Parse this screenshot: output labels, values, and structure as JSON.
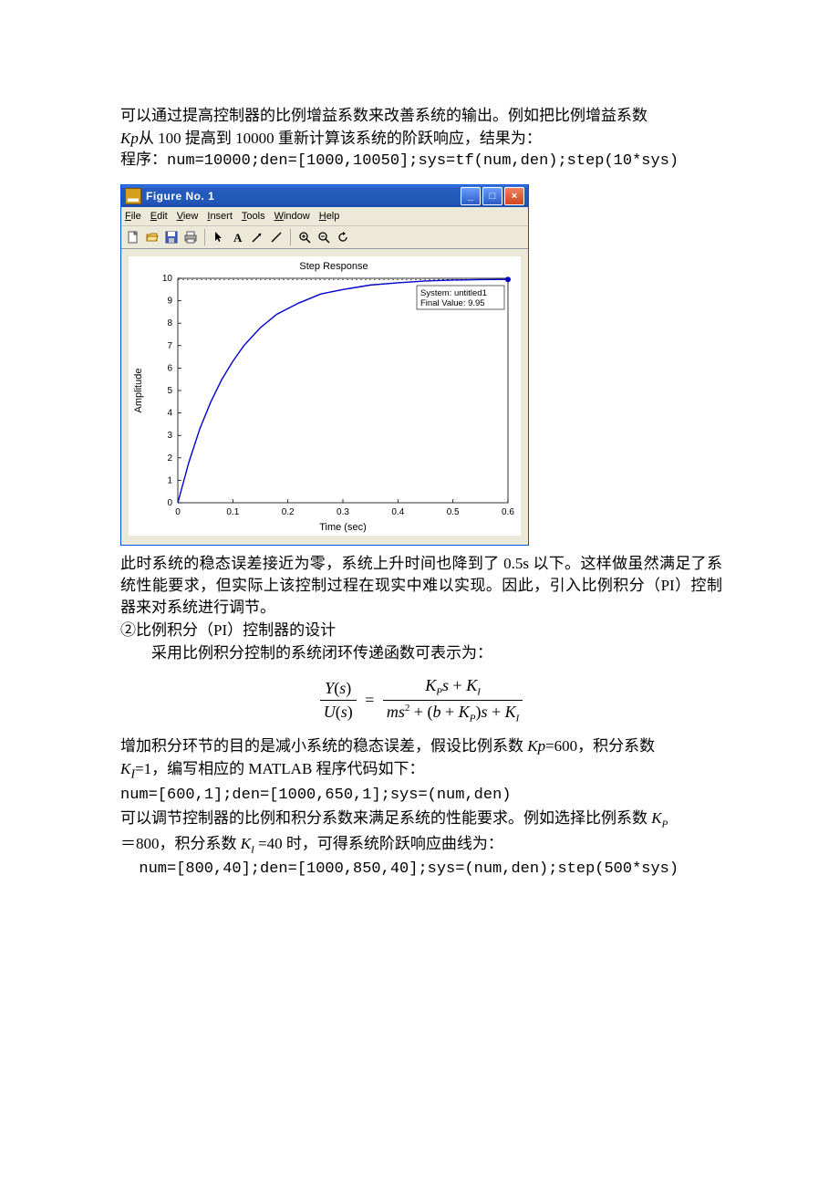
{
  "text": {
    "p1": "可以通过提高控制器的比例增益系数来改善系统的输出。例如把比例增益系数",
    "p2a": "从 100 提高到 10000 重新计算该系统的阶跃响应，结果为：",
    "p3": "程序：num=10000;den=[1000,10050];sys=tf(num,den);step(10*sys)",
    "p4": "此时系统的稳态误差接近为零，系统上升时间也降到了 0.5s 以下。这样做虽然满足了系统性能要求，但实际上该控制过程在现实中难以实现。因此，引入比例积分（PI）控制器来对系统进行调节。",
    "p5": "②比例积分（PI）控制器的设计",
    "p6": "采用比例积分控制的系统闭环传递函数可表示为：",
    "p7a": "增加积分环节的目的是减小系统的稳态误差，假设比例系数 ",
    "p7b": "=600，积分系数",
    "p8a": "=1，编写相应的 MATLAB 程序代码如下：",
    "p9": "num=[600,1];den=[1000,650,1];sys=(num,den)",
    "p10a": "可以调节控制器的比例和积分系数来满足系统的性能要求。例如选择比例系数 ",
    "p11a": "＝800，积分系数 ",
    "p11b": " =40 时，可得系统阶跃响应曲线为：",
    "p12": "num=[800,40];den=[1000,850,40];sys=(num,den);step(500*sys)",
    "kp": "Kp",
    "ki": "K",
    "ki_sub": "I"
  },
  "window": {
    "title": "Figure No. 1",
    "menus": [
      "File",
      "Edit",
      "View",
      "Insert",
      "Tools",
      "Window",
      "Help"
    ]
  },
  "chart_data": {
    "type": "line",
    "title": "Step Response",
    "xlabel": "Time (sec)",
    "ylabel": "Amplitude",
    "xlim": [
      0,
      0.6
    ],
    "ylim": [
      0,
      10
    ],
    "x_ticks": [
      0,
      0.1,
      0.2,
      0.3,
      0.4,
      0.5,
      0.6
    ],
    "y_ticks": [
      0,
      1,
      2,
      3,
      4,
      5,
      6,
      7,
      8,
      9,
      10
    ],
    "x": [
      0,
      0.02,
      0.04,
      0.06,
      0.08,
      0.1,
      0.12,
      0.15,
      0.18,
      0.22,
      0.26,
      0.3,
      0.35,
      0.4,
      0.45,
      0.5,
      0.55,
      0.6
    ],
    "values": [
      0,
      1.8,
      3.3,
      4.5,
      5.5,
      6.3,
      7.0,
      7.8,
      8.4,
      8.9,
      9.3,
      9.5,
      9.7,
      9.8,
      9.88,
      9.92,
      9.94,
      9.95
    ],
    "annotation": {
      "line1": "System: untitled1",
      "line2": "Final Value: 9.95"
    }
  }
}
